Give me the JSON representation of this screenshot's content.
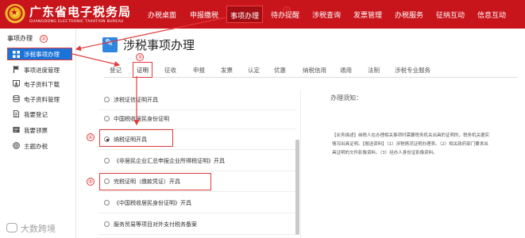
{
  "header": {
    "logo_title": "广东省电子税务局",
    "logo_subtitle": "GUANGDONG ELECTRONIC TAXATION BUREAU",
    "nav": [
      "办税桌面",
      "申报缴税",
      "事项办理",
      "待办提醒",
      "涉税查询",
      "发票管理",
      "办税服务",
      "征纳互动",
      "信息互动"
    ],
    "active_nav": "事项办理"
  },
  "sidebar": {
    "title": "事项办理",
    "items": [
      {
        "label": "涉税事项办理",
        "icon": "grid-icon",
        "active": true
      },
      {
        "label": "事项进度管理",
        "icon": "flag-icon"
      },
      {
        "label": "电子资料下载",
        "icon": "download-icon"
      },
      {
        "label": "电子资料管理",
        "icon": "database-icon"
      },
      {
        "label": "我要登记",
        "icon": "document-icon"
      },
      {
        "label": "我要领票",
        "icon": "ticket-icon"
      },
      {
        "label": "主题办税",
        "icon": "target-icon"
      }
    ]
  },
  "main": {
    "title": "涉税事项办理",
    "tabs": [
      "登记",
      "证明",
      "征收",
      "申报",
      "发票",
      "认定",
      "优惠",
      "纳税信用",
      "通用",
      "法制",
      "涉税专业服务"
    ],
    "active_tab": "证明",
    "list": [
      {
        "label": "涉税证信证明开具",
        "checked": false
      },
      {
        "label": "中国税收居民身份证明",
        "checked": false
      },
      {
        "label": "纳税证明开具",
        "checked": true
      },
      {
        "label": "《非居民企业汇总申报企业所得税证明》开具",
        "checked": false
      },
      {
        "label": "完税证明（缴款凭证）开具",
        "checked": false
      },
      {
        "label": "《中国税收居民身份证明》开具",
        "checked": false
      },
      {
        "label": "服务贸易等项目对外支付税务备案",
        "checked": false
      }
    ],
    "notice_title": "办理须知：",
    "notice_body": "【业务描述】纳税人在办理相关事项时需要税务机关出具的证明的，税务机关据实情况出具证明。【报送资料】（1）涉税情况证明办理表。（2）相关政府部门要求出具证明的文件影像资料。（3）经办人身份证影像资料。"
  },
  "annotations": [
    "①",
    "②",
    "③",
    "④",
    "⑤"
  ],
  "watermark": "大数跨境",
  "colors": {
    "header_bg": "#c8141b",
    "accent_blue": "#1a73d8",
    "highlight_red": "#e23b3b"
  }
}
